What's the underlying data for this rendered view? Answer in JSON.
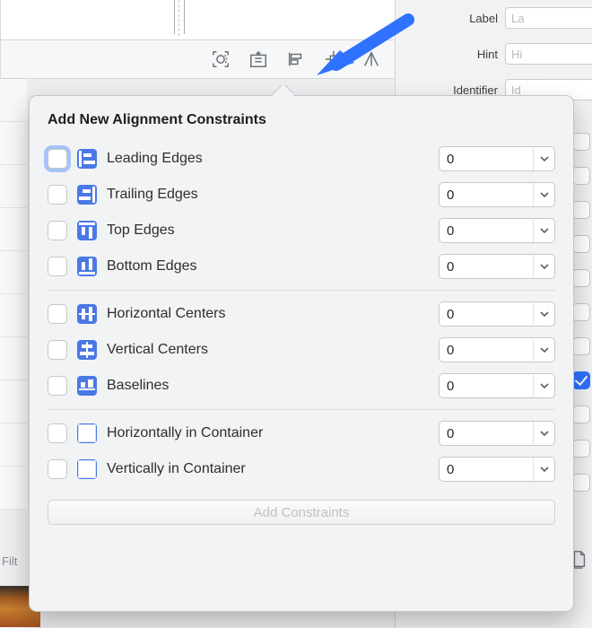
{
  "inspector": {
    "label_field": {
      "label": "Label",
      "placeholder": "La"
    },
    "hint_field": {
      "label": "Hint",
      "placeholder": "Hi"
    },
    "identifier_field": {
      "label": "Identifier",
      "placeholder": "Id"
    }
  },
  "filter_label": "Filt",
  "popover": {
    "title": "Add New Alignment Constraints",
    "add_button": "Add Constraints",
    "groups": [
      {
        "rows": [
          {
            "id": "leading",
            "label": "Leading Edges",
            "value": "0",
            "icon": "align-leading-icon",
            "focused": true
          },
          {
            "id": "trailing",
            "label": "Trailing Edges",
            "value": "0",
            "icon": "align-trailing-icon"
          },
          {
            "id": "top",
            "label": "Top Edges",
            "value": "0",
            "icon": "align-top-icon"
          },
          {
            "id": "bottom",
            "label": "Bottom Edges",
            "value": "0",
            "icon": "align-bottom-icon"
          }
        ]
      },
      {
        "rows": [
          {
            "id": "hcenters",
            "label": "Horizontal Centers",
            "value": "0",
            "icon": "align-hcenters-icon"
          },
          {
            "id": "vcenters",
            "label": "Vertical Centers",
            "value": "0",
            "icon": "align-vcenters-icon"
          },
          {
            "id": "baselines",
            "label": "Baselines",
            "value": "0",
            "icon": "align-baselines-icon"
          }
        ]
      },
      {
        "rows": [
          {
            "id": "hcontainer",
            "label": "Horizontally in Container",
            "value": "0",
            "icon": "align-hcontainer-icon"
          },
          {
            "id": "vcontainer",
            "label": "Vertically in Container",
            "value": "0",
            "icon": "align-vcontainer-icon"
          }
        ]
      }
    ]
  }
}
